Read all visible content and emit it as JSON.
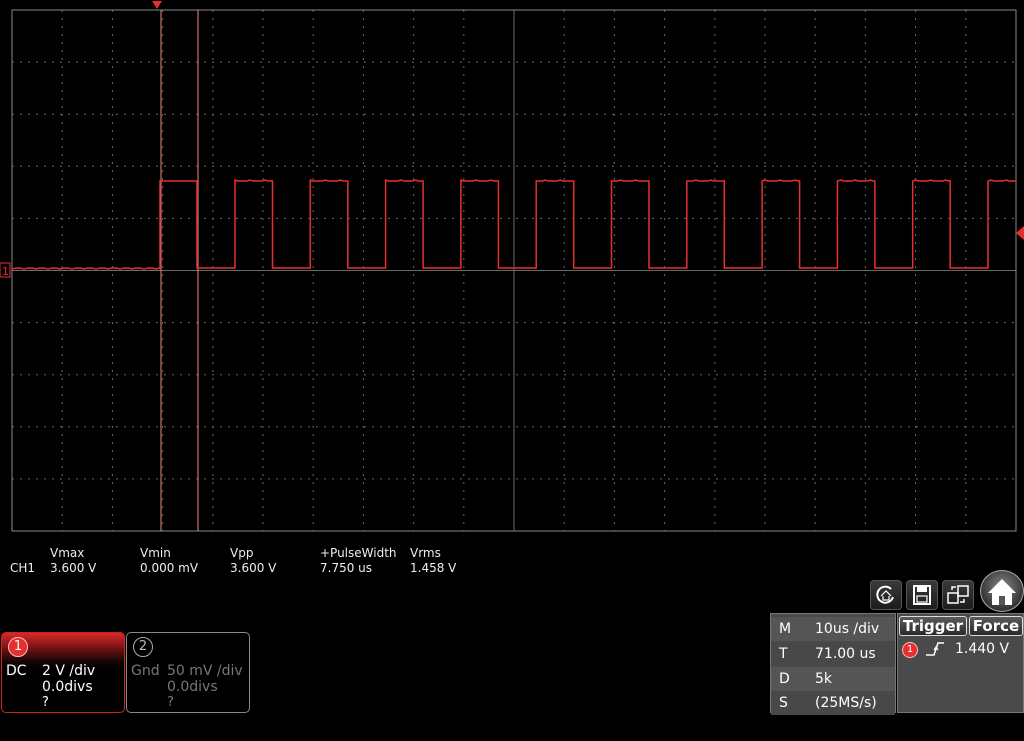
{
  "colors": {
    "trace": "#e53030",
    "grid": "#6a6a6a",
    "cursor": "#f08a8a"
  },
  "channel1_marker": "1",
  "measurements": {
    "row_label": "CH1",
    "columns": [
      {
        "name": "Vmax",
        "value": "3.600 V"
      },
      {
        "name": "Vmin",
        "value": "0.000 mV"
      },
      {
        "name": "Vpp",
        "value": "3.600 V"
      },
      {
        "name": "+PulseWidth",
        "value": "7.750 us"
      },
      {
        "name": "Vrms",
        "value": "1.458 V"
      }
    ]
  },
  "channels": [
    {
      "num": "1",
      "coupling": "DC",
      "scale": "2 V /div",
      "offset": "0.0divs",
      "probe": "?"
    },
    {
      "num": "2",
      "coupling": "Gnd",
      "scale": "50 mV /div",
      "offset": "0.0divs",
      "probe": "?"
    }
  ],
  "toolbar": {
    "icons": [
      "autoset-icon",
      "save-icon",
      "share-icon",
      "home-icon"
    ]
  },
  "timebase": {
    "rows": [
      {
        "key": "M",
        "value": "10us /div"
      },
      {
        "key": "T",
        "value": "71.00 us"
      },
      {
        "key": "D",
        "value": "5k"
      },
      {
        "key": "S",
        "value": "(25MS/s)"
      }
    ]
  },
  "trigger": {
    "trigger_label": "Trigger",
    "force_label": "Force",
    "source": "1",
    "edge": "rising-edge-icon",
    "level": "1.440 V"
  }
}
